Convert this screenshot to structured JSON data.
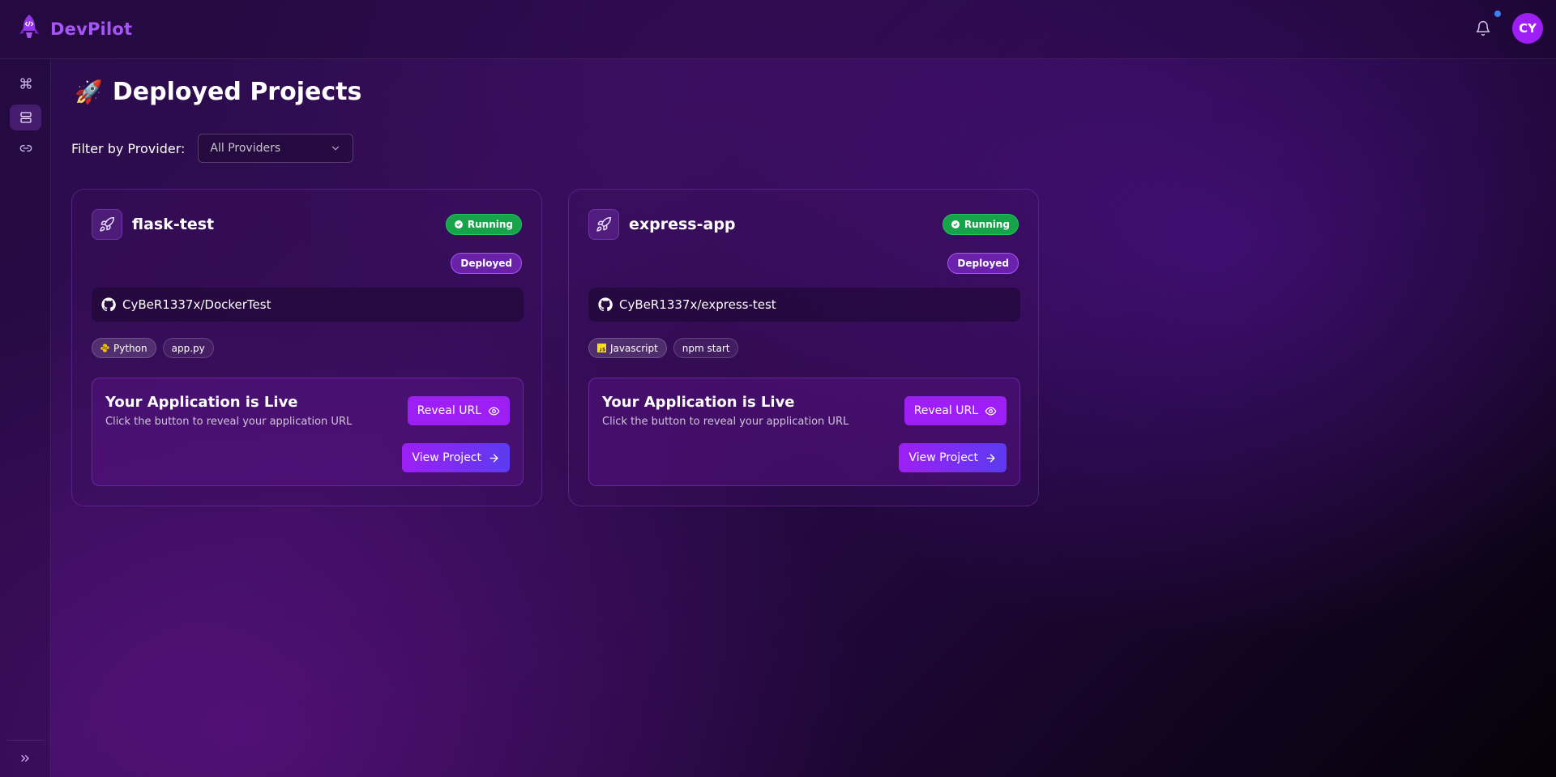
{
  "app": {
    "name": "DevPilot",
    "logo_icon": "rocket-code-icon"
  },
  "header": {
    "avatar_initials": "CY",
    "notification_icon": "bell-icon",
    "notification_dot_color": "#3b82f6"
  },
  "sidebar": {
    "items": [
      {
        "icon": "command-icon",
        "active": false
      },
      {
        "icon": "server-icon",
        "active": true
      },
      {
        "icon": "link-icon",
        "active": false
      }
    ],
    "expand_icon": "chevrons-right-icon"
  },
  "page": {
    "title_emoji": "🚀",
    "title": "Deployed Projects",
    "filter_label": "Filter by Provider:",
    "filter_value": "All Providers"
  },
  "projects": [
    {
      "name": "flask-test",
      "status": "Running",
      "state": "Deployed",
      "repo": "CyBeR1337x/DockerTest",
      "language": "Python",
      "entry": "app.py",
      "live_title": "Your Application is Live",
      "live_subtitle": "Click the button to reveal your application URL",
      "reveal_label": "Reveal URL",
      "view_label": "View Project"
    },
    {
      "name": "express-app",
      "status": "Running",
      "state": "Deployed",
      "repo": "CyBeR1337x/express-test",
      "language": "Javascript",
      "entry": "npm start",
      "live_title": "Your Application is Live",
      "live_subtitle": "Click the button to reveal your application URL",
      "reveal_label": "Reveal URL",
      "view_label": "View Project"
    }
  ],
  "colors": {
    "accent": "#a855f7",
    "button": "#9d1ff5",
    "running": "#16a34a"
  }
}
